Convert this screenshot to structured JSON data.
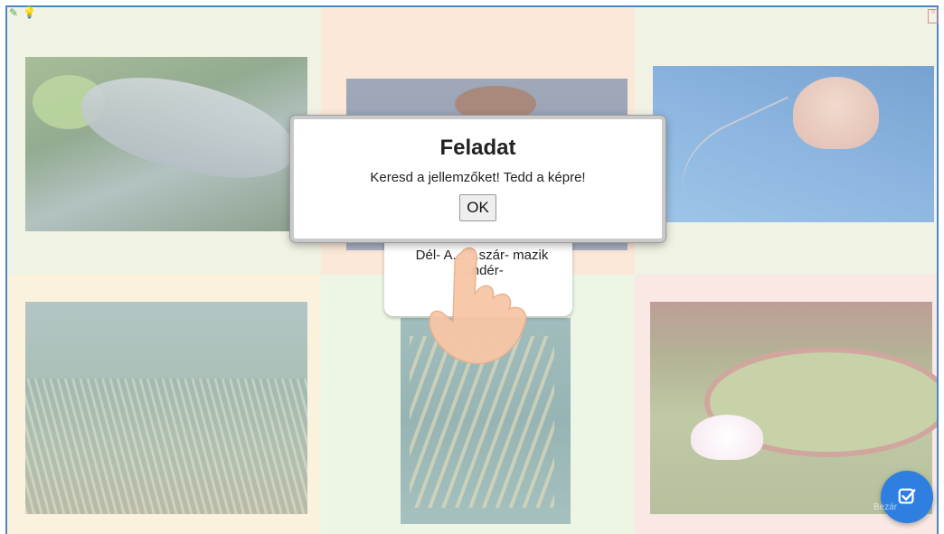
{
  "dialog": {
    "title": "Feladat",
    "message": "Keresd a jellemzőket! Tedd a képre!",
    "ok_label": "OK"
  },
  "card": {
    "text": "Dél- A... ...szár- mazik ...ndér-"
  },
  "toolbar": {
    "icons": [
      "edit-icon",
      "lightbulb-icon"
    ]
  },
  "footer": {
    "hint": "Bezár"
  },
  "colors": {
    "frame_border": "#4a86c8",
    "check_button": "#2f7fe0"
  }
}
